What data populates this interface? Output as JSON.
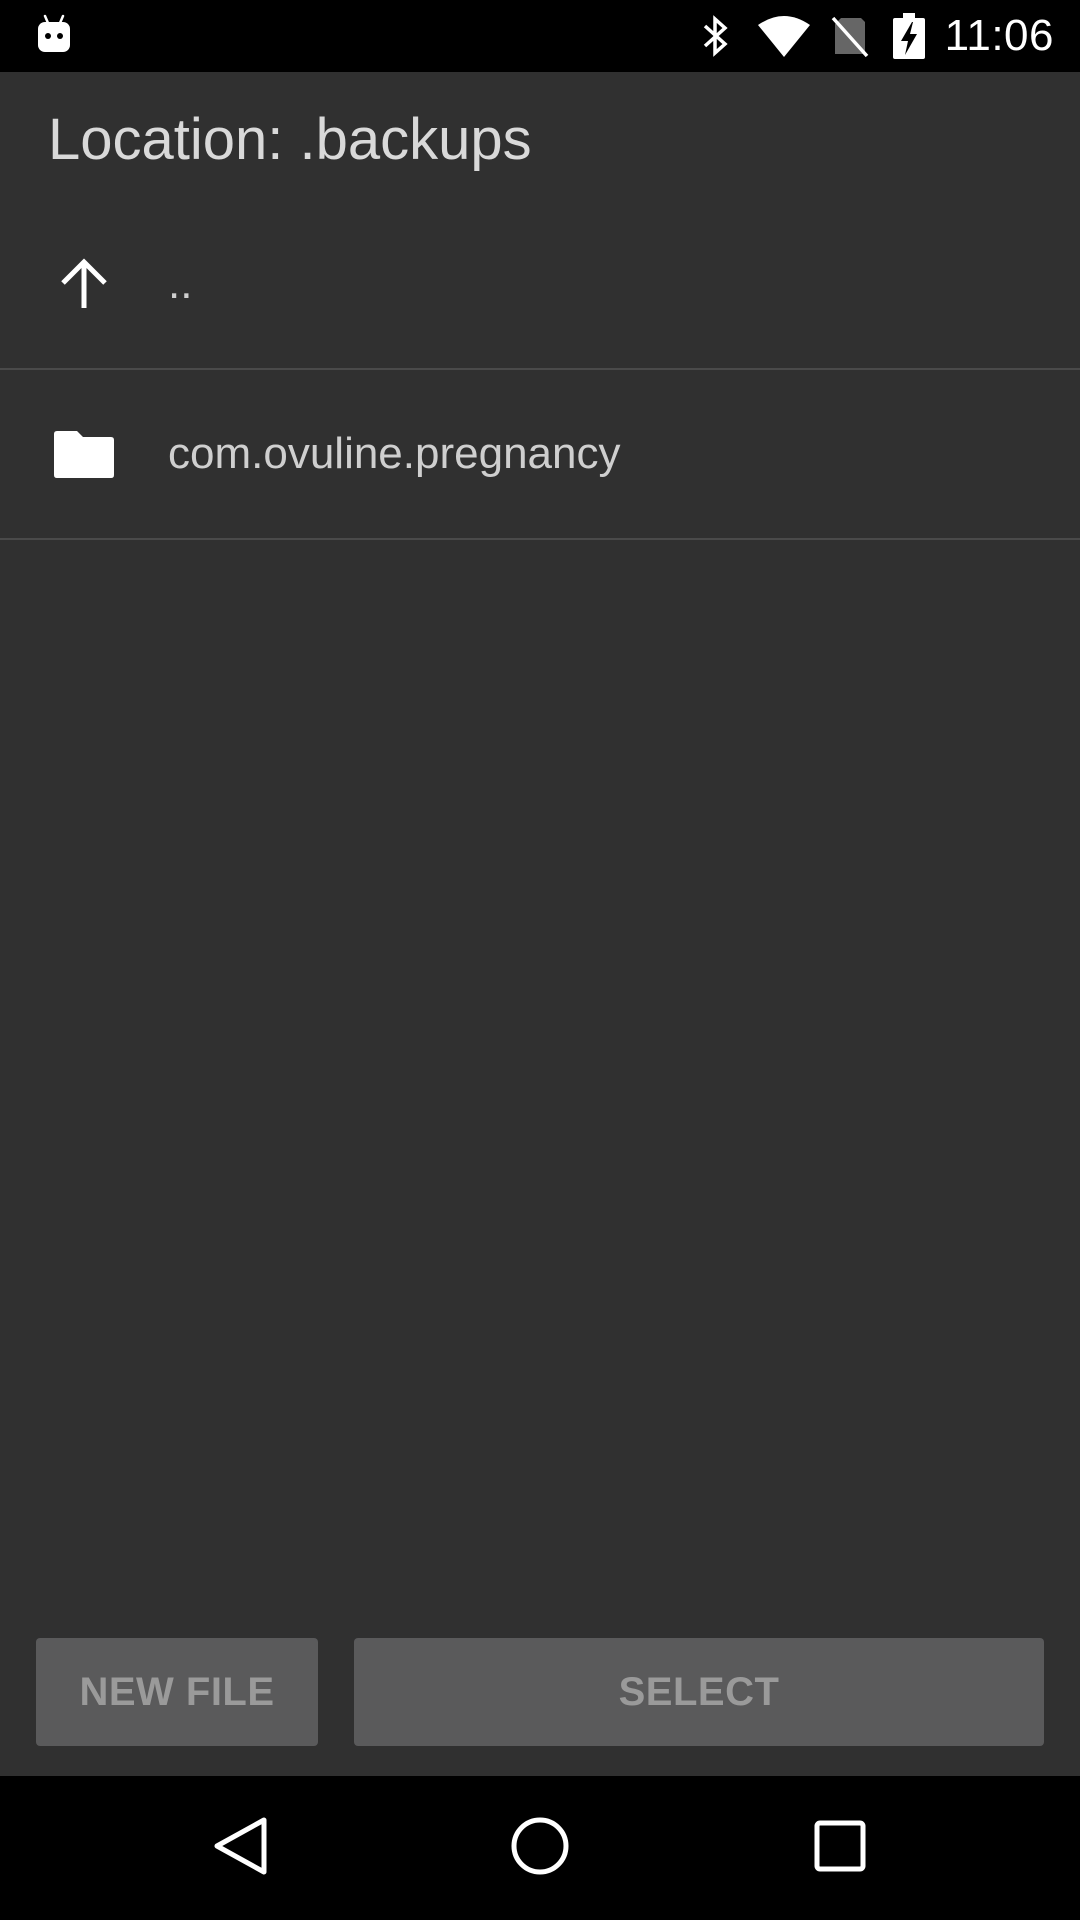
{
  "status_bar": {
    "time": "11:06",
    "icons": [
      "android-debug-icon",
      "bluetooth-icon",
      "wifi-icon",
      "no-sim-icon",
      "battery-charging-icon"
    ]
  },
  "header": {
    "title": "Location:  .backups"
  },
  "file_list": {
    "items": [
      {
        "label": "..",
        "icon": "arrow-up-icon"
      },
      {
        "label": "com.ovuline.pregnancy",
        "icon": "folder-icon"
      }
    ]
  },
  "buttons": {
    "new_file_label": "NEW FILE",
    "select_label": "SELECT"
  },
  "nav_bar": {
    "icons": [
      "back-icon",
      "home-icon",
      "recents-icon"
    ]
  },
  "colors": {
    "background": "#303030",
    "status_bar": "#000000",
    "button_bg": "#5a5a5b",
    "button_text": "#9a9a9a",
    "text_primary": "#d9d9d9",
    "divider": "#4a4a4a"
  }
}
